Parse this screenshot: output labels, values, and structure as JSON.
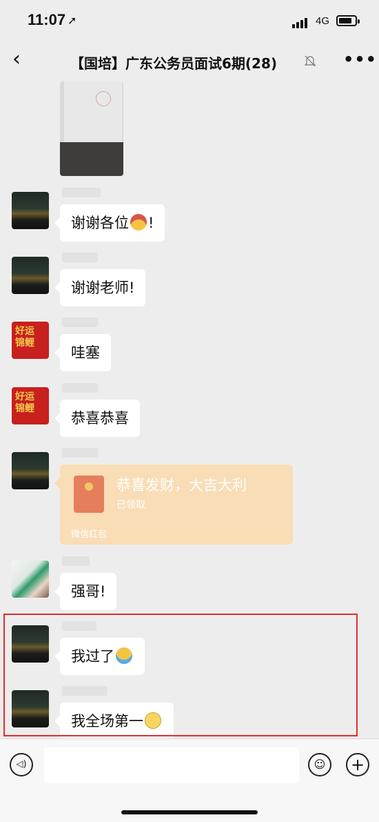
{
  "status": {
    "time": "11:07",
    "network": "4G"
  },
  "header": {
    "back_icon": "chevron-left-icon",
    "title": "【国培】广东公务员面试6期(28)",
    "more_label": "•••"
  },
  "messages": [
    {
      "type": "image",
      "avatar": "night-scene"
    },
    {
      "type": "text",
      "text": "谢谢各位",
      "suffix": "!",
      "avatar": "night-scene",
      "emoji": "sick-face"
    },
    {
      "type": "text",
      "text": "谢谢老师!",
      "avatar": "night-scene"
    },
    {
      "type": "text",
      "text": "哇塞",
      "avatar": "lucky-koi"
    },
    {
      "type": "text",
      "text": "恭喜恭喜",
      "avatar": "lucky-koi"
    },
    {
      "type": "red_packet",
      "title": "恭喜发财，大吉大利",
      "status": "已领取",
      "footer": "微信红包",
      "avatar": "night-scene"
    },
    {
      "type": "text",
      "text": "强哥!",
      "avatar": "child"
    },
    {
      "type": "text",
      "text": "我过了",
      "avatar": "night-scene",
      "emoji": "crying-face"
    },
    {
      "type": "text",
      "text": "我全场第一",
      "avatar": "night-scene",
      "emoji": "flushed-face"
    }
  ],
  "avatar_text": {
    "lucky_koi": "好运\n锦鲤"
  },
  "colors": {
    "highlight_border": "#e32a2a",
    "red_packet": "#f9ddb6",
    "background": "#ededed"
  },
  "input": {
    "voice_icon": "voice-icon",
    "emoji_icon": "emoji-icon",
    "plus_icon": "plus-icon"
  }
}
